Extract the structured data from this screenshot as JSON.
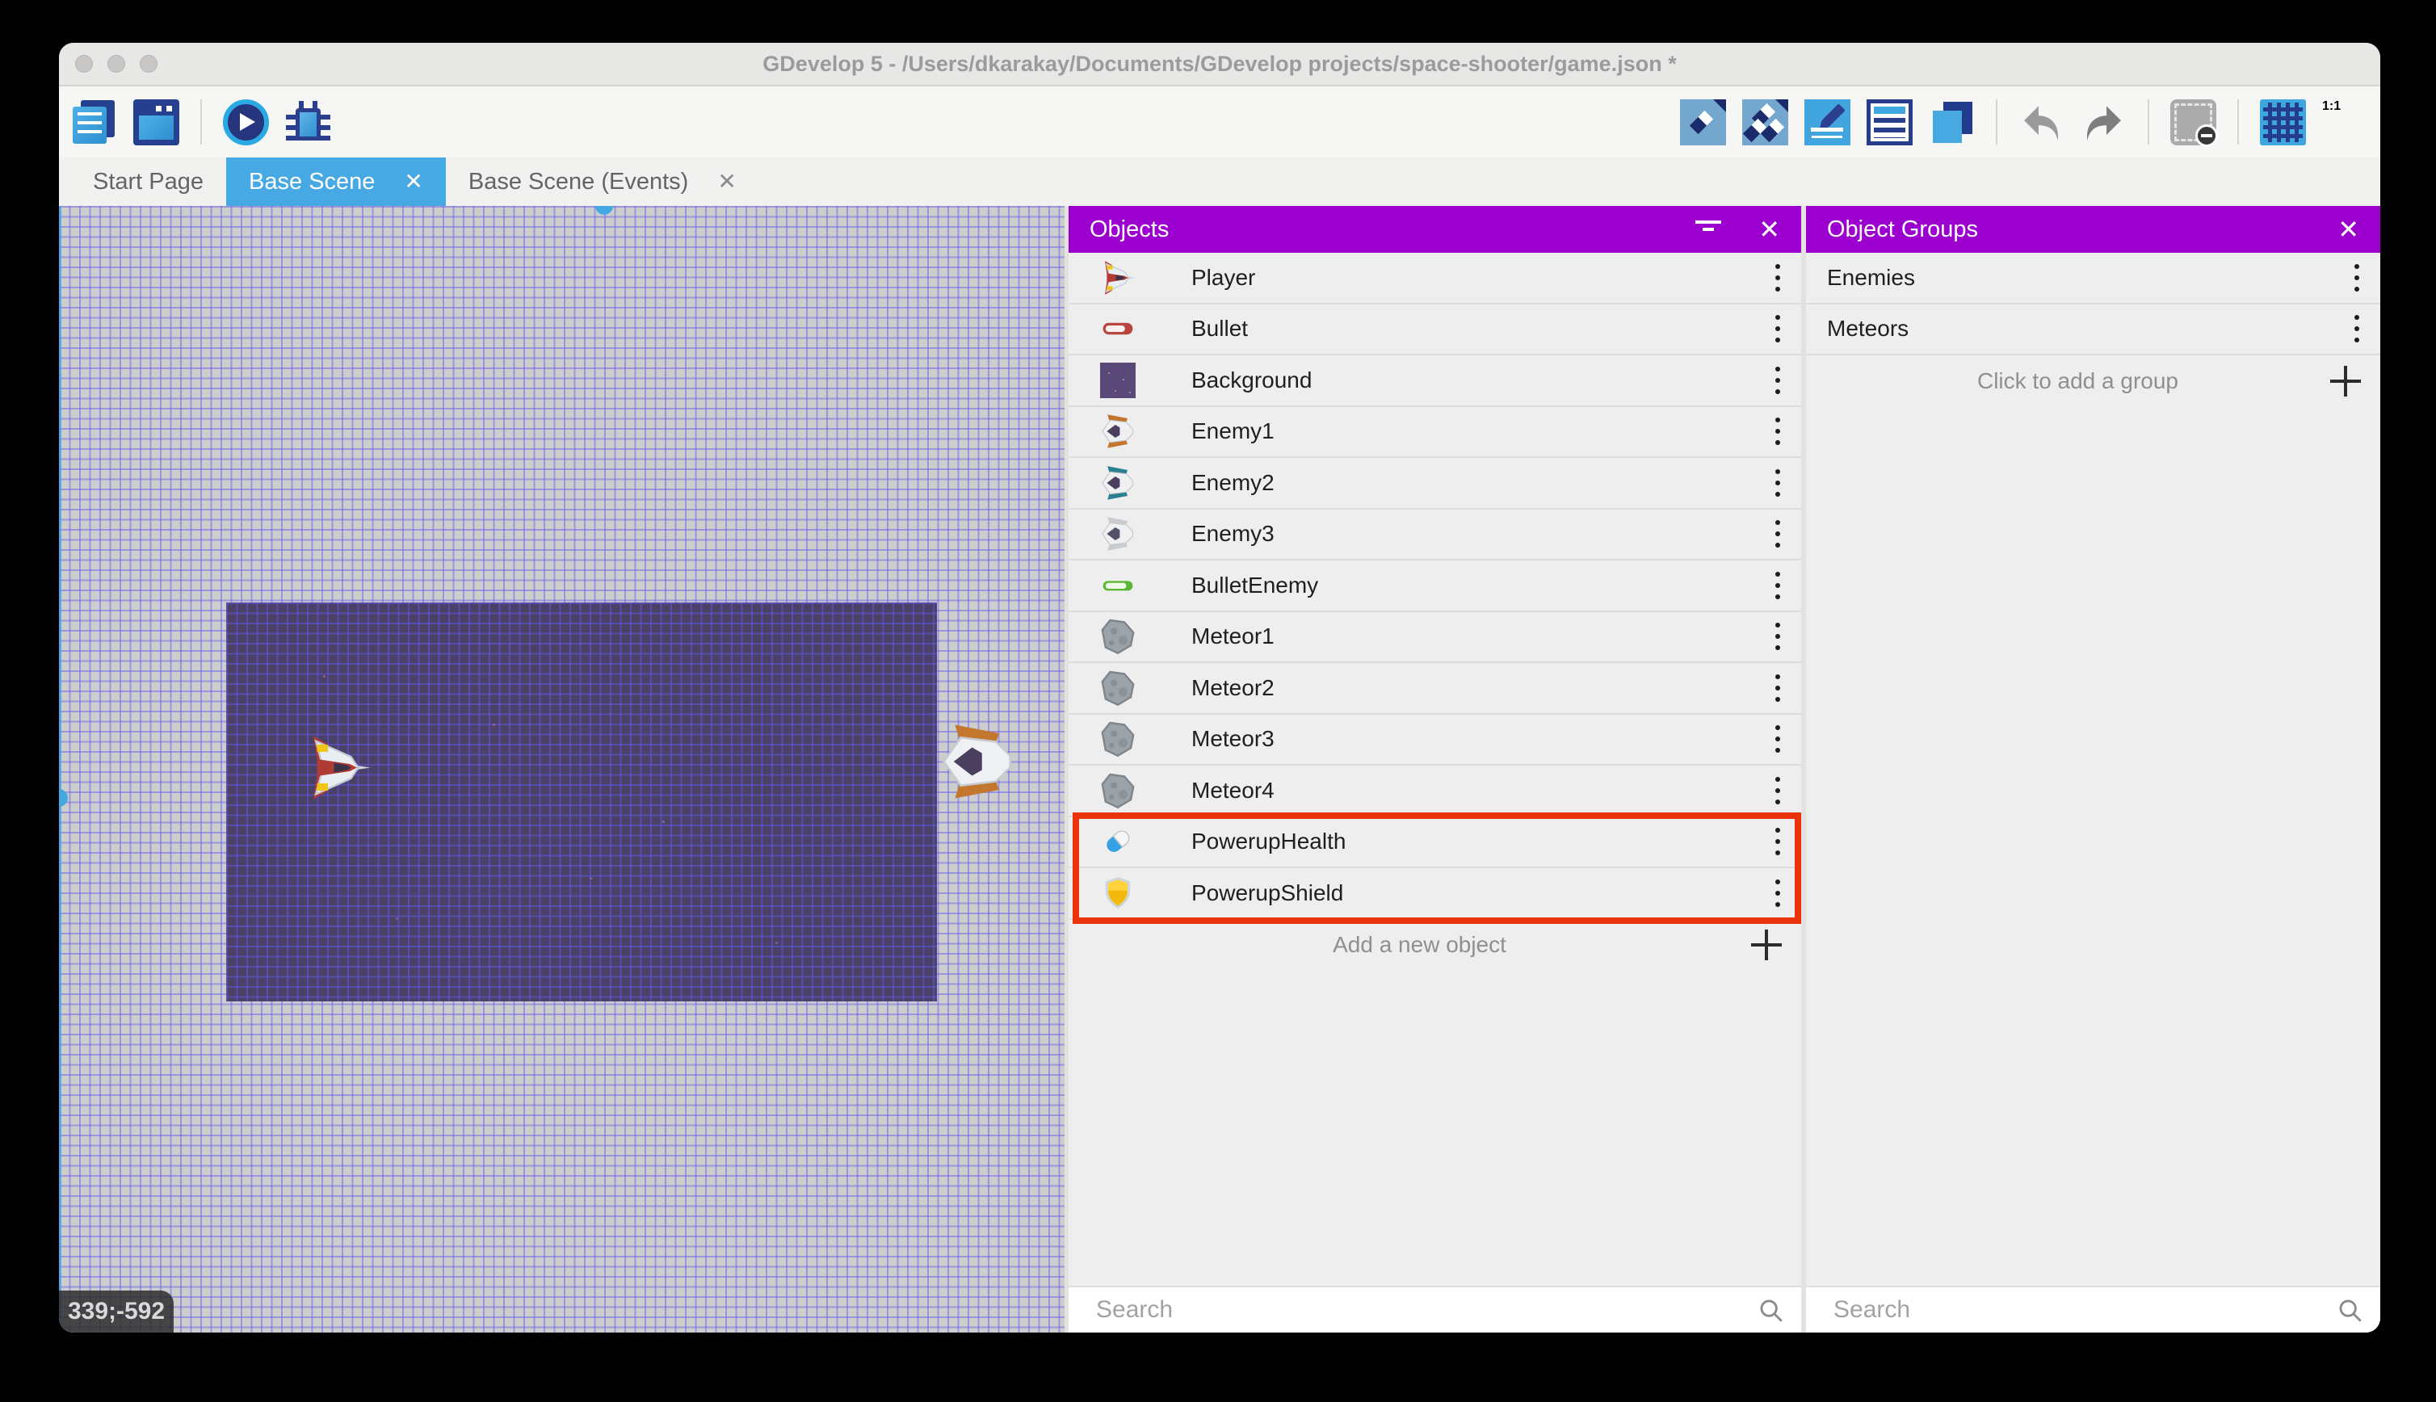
{
  "window": {
    "title": "GDevelop 5 - /Users/dkarakay/Documents/GDevelop projects/space-shooter/game.json *"
  },
  "traffic_lights": [
    "close",
    "minimize",
    "zoom"
  ],
  "toolbar": {
    "left": [
      {
        "icon": "project-manager-icon",
        "type": "pm"
      },
      {
        "icon": "scene-window-icon",
        "type": "win"
      },
      {
        "type": "divider"
      },
      {
        "icon": "play-preview-icon",
        "type": "play"
      },
      {
        "icon": "debug-bug-icon",
        "type": "bug"
      }
    ],
    "right": [
      {
        "icon": "objects-editor-icon",
        "type": "obj"
      },
      {
        "icon": "object-groups-editor-icon",
        "type": "grp"
      },
      {
        "icon": "properties-pencil-icon",
        "type": "props"
      },
      {
        "icon": "instances-list-icon",
        "type": "list"
      },
      {
        "icon": "layers-icon",
        "type": "layers"
      },
      {
        "type": "divider"
      },
      {
        "icon": "undo-icon",
        "type": "undo"
      },
      {
        "icon": "redo-icon",
        "type": "redo"
      },
      {
        "type": "divider"
      },
      {
        "icon": "window-mask-icon",
        "type": "mask"
      },
      {
        "type": "divider"
      },
      {
        "icon": "grid-icon",
        "type": "grid"
      },
      {
        "icon": "zoom-1-1-icon",
        "type": "zoom11",
        "label": "1:1"
      }
    ]
  },
  "tabs": [
    {
      "label": "Start Page",
      "active": false,
      "closable": false
    },
    {
      "label": "Base Scene",
      "active": true,
      "closable": true
    },
    {
      "label": "Base Scene (Events)",
      "active": false,
      "closable": true
    }
  ],
  "canvas": {
    "cursor_position": "339;-592"
  },
  "objects_panel": {
    "title": "Objects",
    "search_placeholder": "Search",
    "add_label": "Add a new object",
    "items": [
      {
        "label": "Player",
        "icon": "player-ship-icon"
      },
      {
        "label": "Bullet",
        "icon": "red-bullet-icon"
      },
      {
        "label": "Background",
        "icon": "background-tile-icon"
      },
      {
        "label": "Enemy1",
        "icon": "enemy-orange-ship-icon"
      },
      {
        "label": "Enemy2",
        "icon": "enemy-teal-ship-icon"
      },
      {
        "label": "Enemy3",
        "icon": "enemy-gray-ship-icon"
      },
      {
        "label": "BulletEnemy",
        "icon": "green-bullet-icon"
      },
      {
        "label": "Meteor1",
        "icon": "meteor-icon"
      },
      {
        "label": "Meteor2",
        "icon": "meteor-icon"
      },
      {
        "label": "Meteor3",
        "icon": "meteor-icon"
      },
      {
        "label": "Meteor4",
        "icon": "meteor-icon"
      },
      {
        "label": "PowerupHealth",
        "icon": "health-pill-icon",
        "highlighted": true
      },
      {
        "label": "PowerupShield",
        "icon": "shield-icon",
        "highlighted": true
      }
    ]
  },
  "groups_panel": {
    "title": "Object Groups",
    "search_placeholder": "Search",
    "add_label": "Click to add a group",
    "items": [
      {
        "label": "Enemies"
      },
      {
        "label": "Meteors"
      }
    ]
  },
  "colors": {
    "accent_purple": "#9c00ce",
    "tab_blue": "#47a9e3",
    "highlight_red": "#e8330c"
  }
}
